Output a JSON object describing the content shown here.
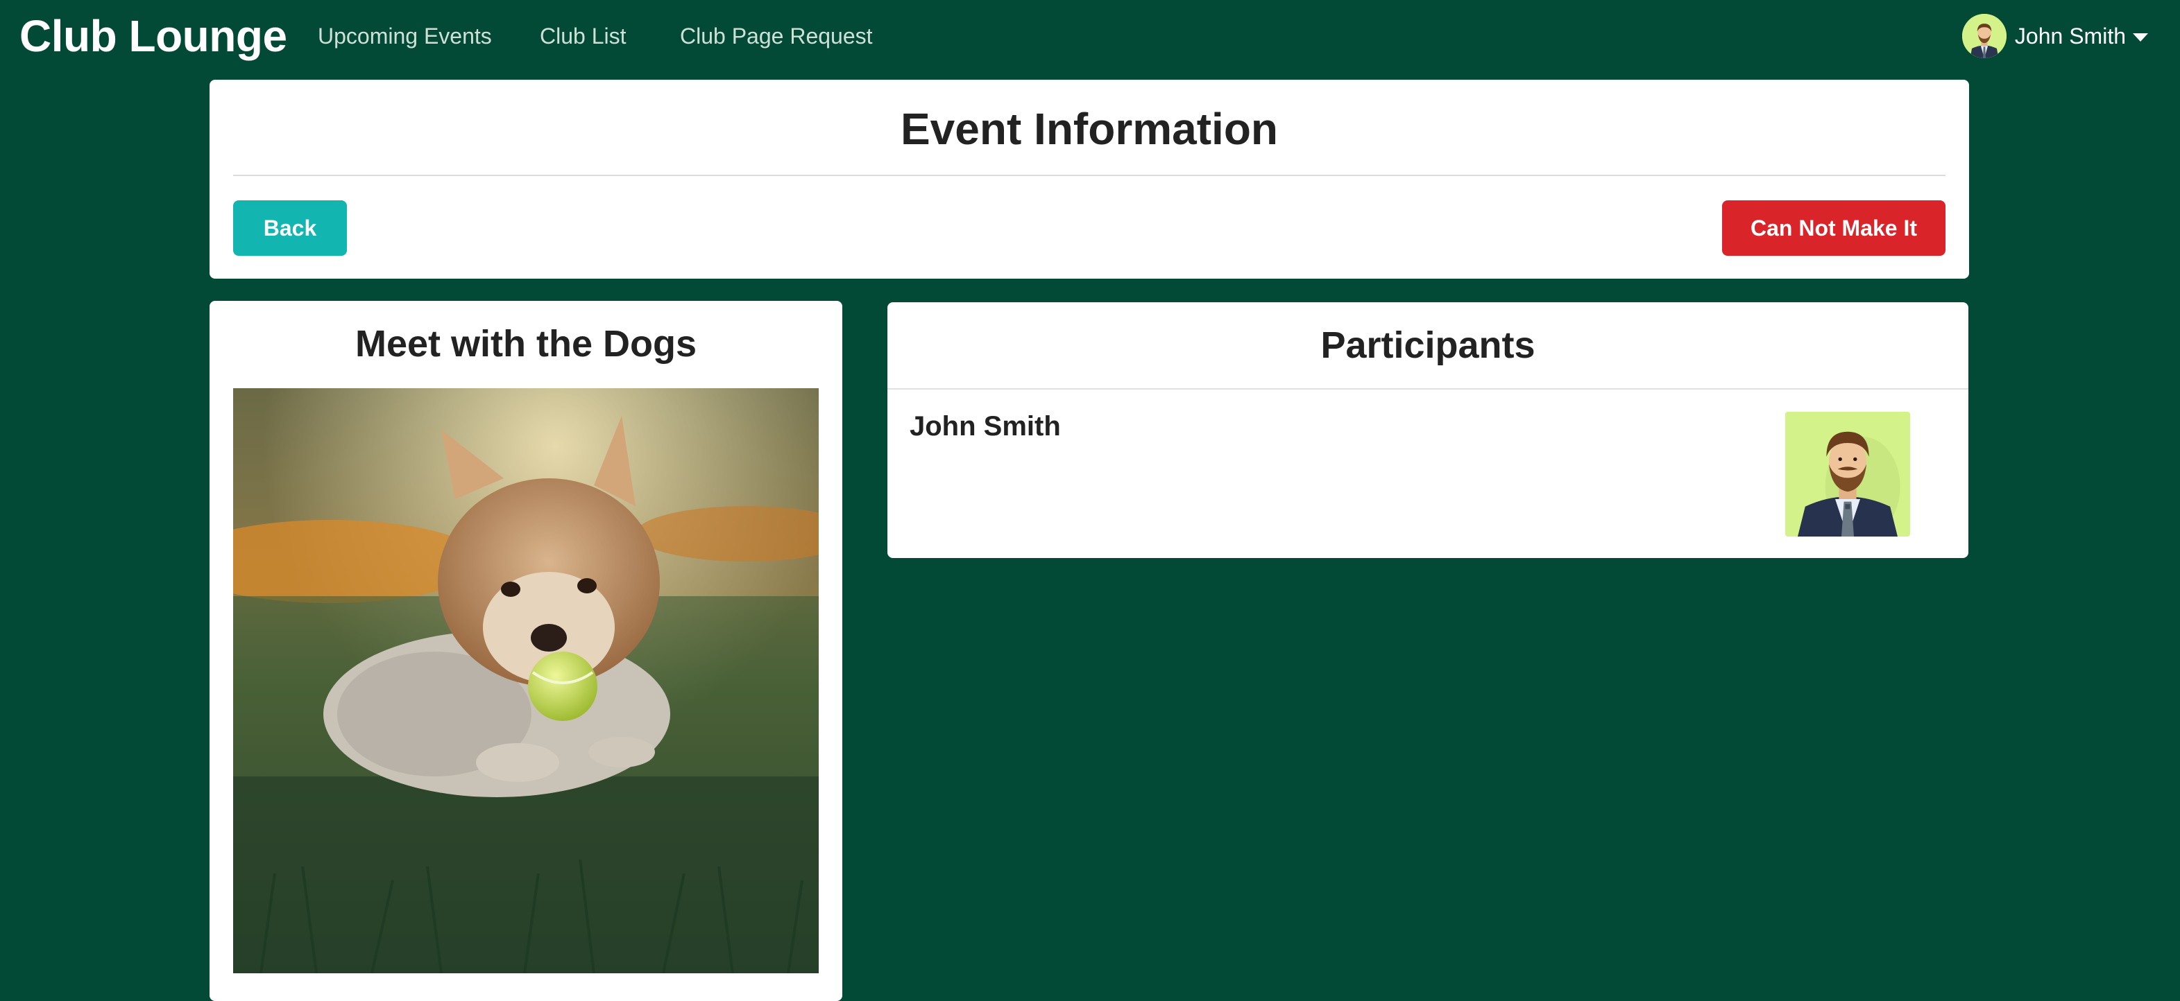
{
  "navbar": {
    "brand": "Club Lounge",
    "links": [
      "Upcoming Events",
      "Club List",
      "Club Page Request"
    ],
    "user_name": "John Smith"
  },
  "header": {
    "title": "Event Information",
    "back_label": "Back",
    "cant_make_it_label": "Can Not Make It"
  },
  "event": {
    "title": "Meet with the Dogs"
  },
  "participants": {
    "title": "Participants",
    "list": [
      {
        "name": "John Smith"
      }
    ]
  },
  "colors": {
    "background": "#024a35",
    "back_button": "#13b5b1",
    "cant_make_it_button": "#d9252a",
    "avatar_background": "#d4f28a"
  }
}
